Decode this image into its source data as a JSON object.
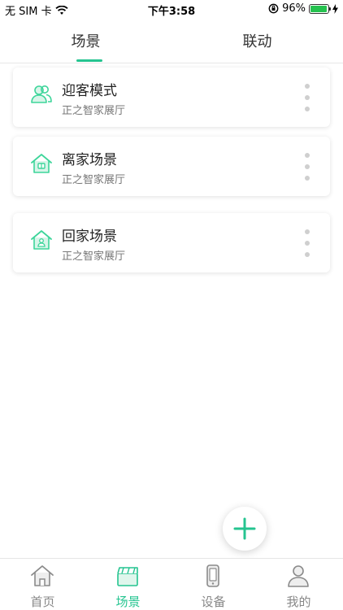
{
  "status_bar": {
    "carrier": "无 SIM 卡",
    "time": "下午3:58",
    "battery": "96%",
    "battery_fraction": 0.96
  },
  "top_tabs": [
    {
      "label": "场景",
      "active": true
    },
    {
      "label": "联动",
      "active": false
    }
  ],
  "scenes": [
    {
      "title": "迎客模式",
      "subtitle": "正之智家展厅",
      "icon": "people-icon"
    },
    {
      "title": "离家场景",
      "subtitle": "正之智家展厅",
      "icon": "house-leave-icon"
    },
    {
      "title": "回家场景",
      "subtitle": "正之智家展厅",
      "icon": "house-home-icon"
    }
  ],
  "fab": {
    "icon": "plus-icon"
  },
  "bottom_nav": [
    {
      "label": "首页",
      "icon": "home-icon",
      "active": false
    },
    {
      "label": "场景",
      "icon": "clapperboard-icon",
      "active": true
    },
    {
      "label": "设备",
      "icon": "phone-device-icon",
      "active": false
    },
    {
      "label": "我的",
      "icon": "user-icon",
      "active": false
    }
  ],
  "colors": {
    "accent": "#25c490",
    "scene_icon": "#3dd59a",
    "inactive": "#888888"
  }
}
